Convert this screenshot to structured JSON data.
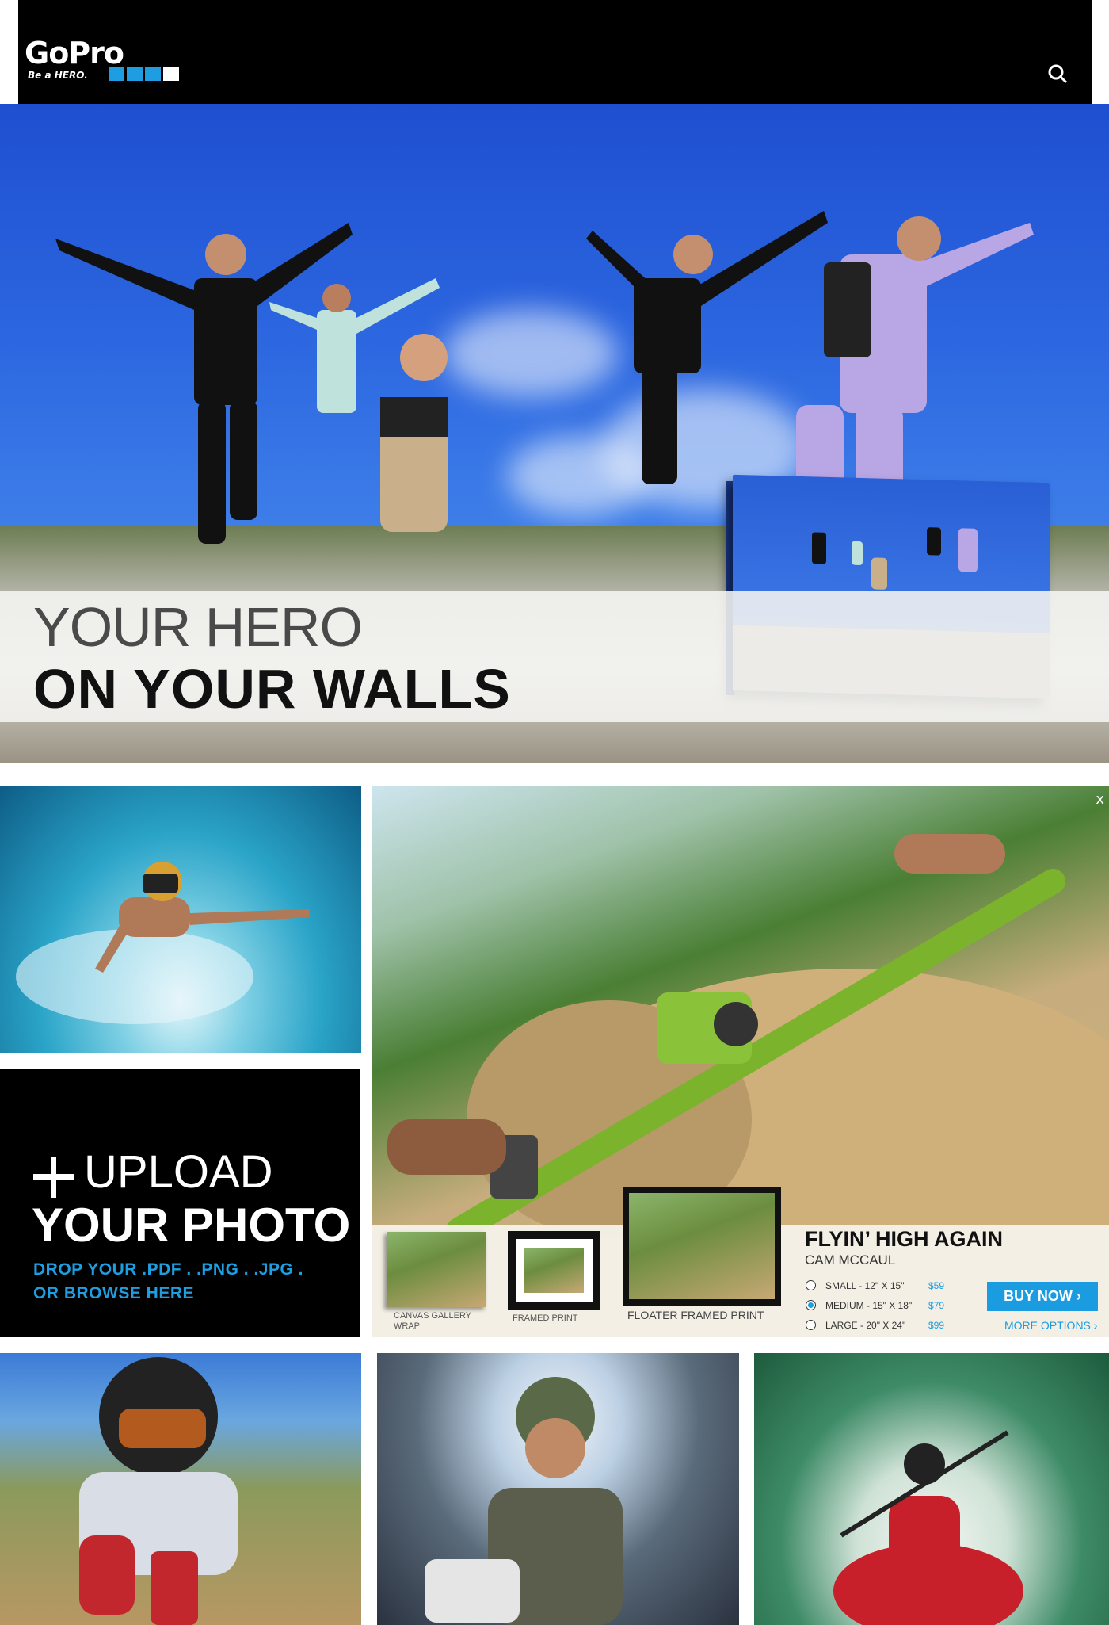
{
  "header": {
    "logo_text": "GoPro",
    "logo_tagline": "Be a HERO.",
    "logo_squares": [
      "#1e9ee0",
      "#1e9ee0",
      "#1e9ee0",
      "#1e9ee0"
    ],
    "search_icon": "search-icon"
  },
  "hero": {
    "line1": "YOUR HERO",
    "line2": "ON YOUR WALLS"
  },
  "upload": {
    "line1": "UPLOAD",
    "line2": "YOUR PHOTO",
    "sub1": "DROP YOUR  .PDF . .PNG . .JPG .",
    "sub2": "OR BROWSE HERE",
    "plus_icon": "plus-icon"
  },
  "product": {
    "close": "x",
    "title": "FLYIN’ HIGH AGAIN",
    "artist": "CAM MCCAUL",
    "print_types": [
      "CANVAS GALLERY WRAP",
      "FRAMED PRINT",
      "FLOATER FRAMED PRINT"
    ],
    "sizes": [
      {
        "name": "SMALL - 12\" X 15\"",
        "price": "$59",
        "selected": false
      },
      {
        "name": "MEDIUM - 15\" X 18\"",
        "price": "$79",
        "selected": true
      },
      {
        "name": "LARGE - 20\" X 24\"",
        "price": "$99",
        "selected": false
      }
    ],
    "buy_label": "BUY NOW",
    "more_label": "MORE OPTIONS"
  },
  "colors": {
    "accent": "#1b9be0",
    "header_bg": "#000000"
  }
}
